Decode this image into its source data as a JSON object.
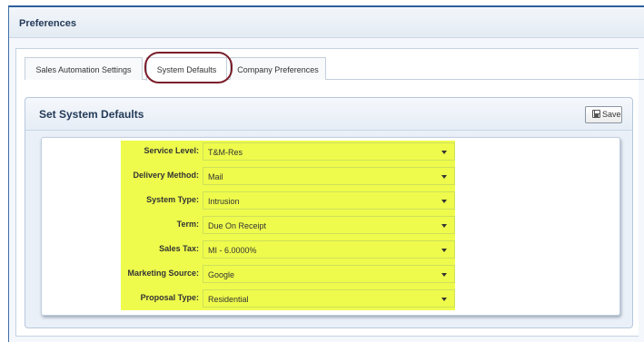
{
  "header": {
    "title": "Preferences"
  },
  "tabs": [
    {
      "label": "Sales Automation Settings"
    },
    {
      "label": "System Defaults"
    },
    {
      "label": "Company Preferences"
    }
  ],
  "active_tab": "System Defaults",
  "panel": {
    "title": "Set System Defaults",
    "save_label": "Save"
  },
  "fields": [
    {
      "label": "Service Level:",
      "value": "T&M-Res"
    },
    {
      "label": "Delivery Method:",
      "value": "Mail"
    },
    {
      "label": "System Type:",
      "value": "Intrusion"
    },
    {
      "label": "Term:",
      "value": "Due On Receipt"
    },
    {
      "label": "Sales Tax:",
      "value": "MI - 6.0000%"
    },
    {
      "label": "Marketing Source:",
      "value": "Google"
    },
    {
      "label": "Proposal Type:",
      "value": "Residential"
    }
  ],
  "colors": {
    "highlight": "#eefb4c",
    "tab_ring": "#7b1e2b",
    "header_border": "#2d5f9a"
  }
}
